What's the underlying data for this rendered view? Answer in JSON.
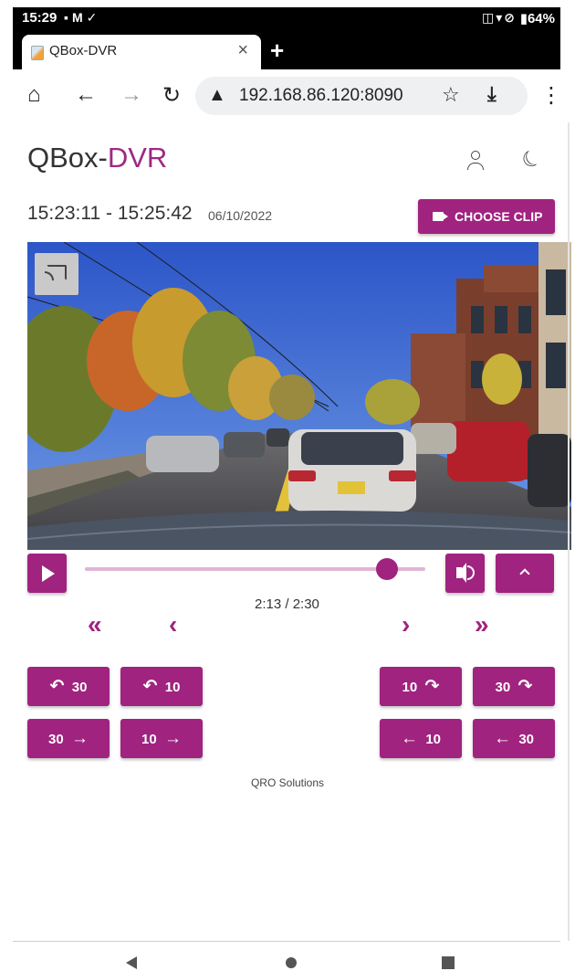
{
  "status_bar": {
    "time": "15:29",
    "left_icons": [
      "image-icon",
      "gmail-icon",
      "check-icon"
    ],
    "right_icons": [
      "vibrate-icon",
      "wifi-icon",
      "no-sim-icon"
    ],
    "battery": "64%"
  },
  "browser": {
    "tab_title": "QBox-DVR",
    "close_tab": "×",
    "new_tab": "+",
    "url": "192.168.86.120:8090",
    "icons": [
      "home-icon",
      "back-icon",
      "forward-icon",
      "reload-icon",
      "not-secure-icon",
      "bookmark-star-icon",
      "download-icon",
      "menu-icon"
    ]
  },
  "app": {
    "title_part1": "QBox-",
    "title_part2": "DVR",
    "accent_color": "#a0237f",
    "header_icons": [
      "user-icon",
      "dark-mode-moon-icon"
    ],
    "time_range": "15:23:11 - 15:25:42",
    "date": "06/10/2022",
    "choose_clip_label": "CHOOSE CLIP"
  },
  "player": {
    "cast_icon": "cast-icon",
    "progress_fraction": 0.8867,
    "time_readout": "2:13 / 2:30",
    "nav": {
      "first": "«",
      "prev": "‹",
      "next": "›",
      "last": "»"
    }
  },
  "skip_buttons": {
    "rewind_30": {
      "icon": "↶",
      "label": "30"
    },
    "rewind_10": {
      "icon": "↶",
      "label": "10"
    },
    "forward_10": {
      "label": "10",
      "icon": "↷"
    },
    "forward_30": {
      "label": "30",
      "icon": "↷"
    },
    "step_fwd_30": {
      "label": "30",
      "icon": "→"
    },
    "step_fwd_10": {
      "label": "10",
      "icon": "→"
    },
    "step_back_10": {
      "icon": "←",
      "label": "10"
    },
    "step_back_30": {
      "icon": "←",
      "label": "30"
    }
  },
  "footer": "QRO Solutions"
}
